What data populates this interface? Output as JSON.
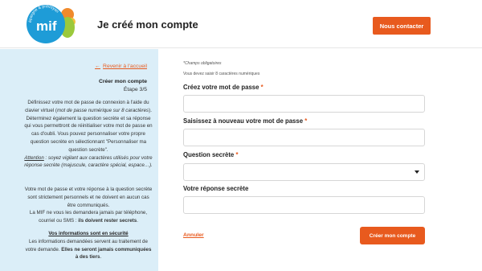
{
  "header": {
    "logo_text": "mif",
    "logo_tagline": "épargne & prévoyance",
    "title": "Je créé mon compte",
    "contact_button": "Nous contacter"
  },
  "sidebar": {
    "back_link": "Revenir à l'accueil",
    "title": "Créer mon compte",
    "step": "Étape 3/5",
    "para1_a": "Définissez votre mot de passe de connexion à l'aide du clavier virtuel (",
    "para1_b": "mot de passe numérique sur 8 caractères",
    "para1_c": ").",
    "para2": "Déterminez également la question secrète et sa réponse qui vous permettront de réinitialiser votre mot de passe en cas d'oubli. Vous pouvez personnaliser votre propre question secrète en sélectionnant \"Personnaliser ma question secrète\".",
    "attention_label": "Attention",
    "attention_text": " : soyez vigilant aux caractères utilisés pour votre réponse secrète (majuscule, caractère spécial, espace…).",
    "para3": "Votre mot de passe et votre réponse à la question secrète sont strictement personnels et ne doivent en aucun cas être communiqués.",
    "para4_a": "La MIF ne vous les demandera jamais par téléphone, courriel ou SMS : ",
    "para4_b": "ils doivent rester secrets",
    "para4_c": ".",
    "security_title": "Vos informations sont en sécurité",
    "security_a": "Les informations demandées servent au traitement de votre demande. ",
    "security_b": "Elles ne seront jamais communiquées à des tiers",
    "security_c": "."
  },
  "form": {
    "required_note": "*Champs obligatoires",
    "hint": "Vous devez saisir 8 caractères numériques",
    "password_label": "Créez votre mot de passe ",
    "confirm_label": "Saisissez à nouveau votre mot de passe ",
    "question_label": "Question secrète ",
    "answer_label": "Votre réponse secrète",
    "star": "*",
    "password_value": "",
    "confirm_value": "",
    "question_selected": "",
    "answer_value": "",
    "cancel_link": "Annuler",
    "submit_button": "Créer mon compte"
  },
  "colors": {
    "accent": "#e85a1e",
    "sidebar_bg": "#dbeef8",
    "logo_blue": "#1e9cd7"
  }
}
